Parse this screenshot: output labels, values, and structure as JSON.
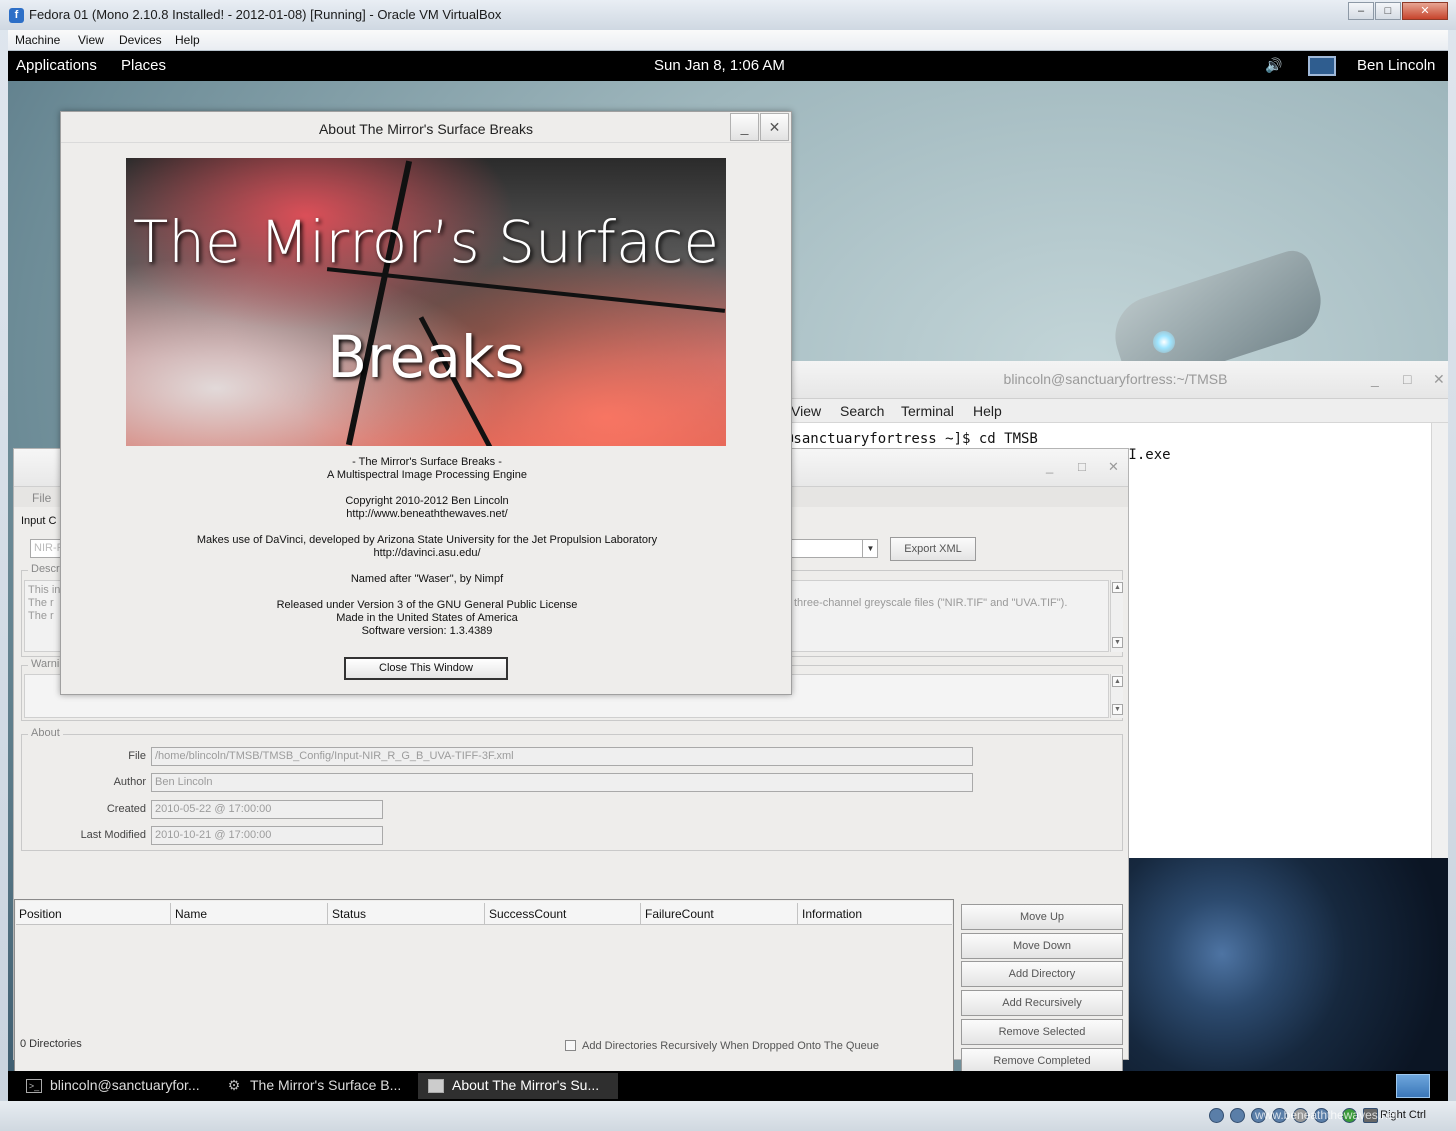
{
  "host": {
    "title": "Fedora 01 (Mono 2.10.8 Installed! - 2012-01-08) [Running] - Oracle VM VirtualBox",
    "menu": [
      "Machine",
      "View",
      "Devices",
      "Help"
    ],
    "status": {
      "host_key": "Right Ctrl",
      "watermark": "www.beneaththewaves.net"
    }
  },
  "gnome": {
    "applications": "Applications",
    "places": "Places",
    "clock": "Sun Jan  8,  1:06 AM",
    "user": "Ben Lincoln"
  },
  "terminal": {
    "title": "blincoln@sanctuaryfortress:~/TMSB",
    "menu": [
      "View",
      "Search",
      "Terminal",
      "Help"
    ],
    "line1": "@sanctuaryfortress ~]$ cd TMSB",
    "line2": "UI.exe"
  },
  "main": {
    "menu_file": "File",
    "input_config_label": "Input C",
    "dropdown_value": "NIR-R",
    "export_xml": "Export XML",
    "description_legend": "Descr",
    "description_lines": [
      "This in",
      "The r",
      "The r"
    ],
    "description_tail": "three-channel greyscale files (\"NIR.TIF\" and \"UVA.TIF\").",
    "warnings_legend": "Warni",
    "about_legend": "About",
    "file_label": "File",
    "file_value": "/home/blincoln/TMSB/TMSB_Config/Input-NIR_R_G_B_UVA-TIFF-3F.xml",
    "author_label": "Author",
    "author_value": "Ben Lincoln",
    "created_label": "Created",
    "created_value": "2010-05-22 @ 17:00:00",
    "modified_label": "Last Modified",
    "modified_value": "2010-10-21 @ 17:00:00",
    "columns": [
      "Position",
      "Name",
      "Status",
      "SuccessCount",
      "FailureCount",
      "Information"
    ],
    "buttons": {
      "move_up": "Move Up",
      "move_down": "Move Down",
      "add_directory": "Add Directory",
      "add_recursively": "Add Recursively",
      "remove_selected": "Remove Selected",
      "remove_completed": "Remove Completed"
    },
    "dir_count": "0 Directories",
    "recursive_checkbox": "Add Directories Recursively When Dropped Onto The Queue"
  },
  "about": {
    "title": "About The Mirror's Surface Breaks",
    "banner_line1": "The Mirror’s Surface",
    "banner_line2": "Breaks",
    "app_line": "- The Mirror's Surface Breaks -",
    "subtitle": "A Multispectral Image Processing Engine",
    "copyright": "Copyright 2010-2012 Ben Lincoln",
    "url": "http://www.beneaththewaves.net/",
    "davinci": "Makes use of DaVinci, developed by Arizona State University for the Jet Propulsion Laboratory",
    "davinci_url": "http://davinci.asu.edu/",
    "named_after": "Named after \"Waser\", by Nimpf",
    "license": "Released under Version 3 of the GNU General Public License",
    "made_in": "Made in the United States of America",
    "version": "Software version: 1.3.4389",
    "close": "Close This Window"
  },
  "taskbar": {
    "task1": "blincoln@sanctuaryfor...",
    "task2": "The Mirror's Surface B...",
    "task3": "About The Mirror's Su..."
  }
}
